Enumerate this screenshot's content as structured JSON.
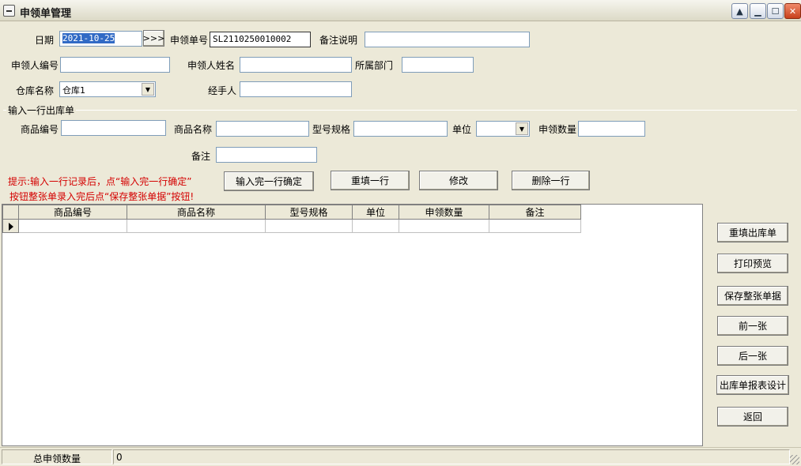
{
  "window": {
    "title": "申领单管理"
  },
  "header": {
    "date_label": "日期",
    "date_value": "2021-10-25",
    "date_picker_label": ">>>",
    "order_no_label": "申领单号",
    "order_no_value": "SL2110250010002",
    "remark_label": "备注说明",
    "remark_value": "",
    "applicant_id_label": "申领人编号",
    "applicant_id_value": "",
    "applicant_name_label": "申领人姓名",
    "applicant_name_value": "",
    "department_label": "所属部门",
    "department_value": "",
    "warehouse_label": "仓库名称",
    "warehouse_value": "仓库1",
    "handler_label": "经手人",
    "handler_value": ""
  },
  "entry": {
    "group_title": "输入一行出库单",
    "product_id_label": "商品编号",
    "product_id_value": "",
    "product_name_label": "商品名称",
    "product_name_value": "",
    "spec_label": "型号规格",
    "spec_value": "",
    "unit_label": "单位",
    "unit_value": "",
    "qty_label": "申领数量",
    "qty_value": "",
    "note_label": "备注",
    "note_value": ""
  },
  "hints": {
    "line1": "提示:输入一行记录后，点“输入完一行确定”",
    "line2": "按钮整张单录入完后点“保存整张单据”按钮!"
  },
  "row_buttons": {
    "confirm_row": "输入完一行确定",
    "refill_row": "重填一行",
    "modify": "修改",
    "delete_row": "删除一行"
  },
  "grid": {
    "columns": [
      "商品编号",
      "商品名称",
      "型号规格",
      "单位",
      "申领数量",
      "备注"
    ],
    "rows": [
      [
        "",
        "",
        "",
        "",
        "",
        ""
      ]
    ]
  },
  "side_buttons": {
    "refill_form": "重填出库单",
    "print_preview": "打印预览",
    "save_form": "保存整张单据",
    "prev": "前一张",
    "next": "后一张",
    "report_design": "出库单报表设计",
    "back": "返回"
  },
  "status": {
    "total_label": "总申领数量",
    "total_value": "0"
  }
}
